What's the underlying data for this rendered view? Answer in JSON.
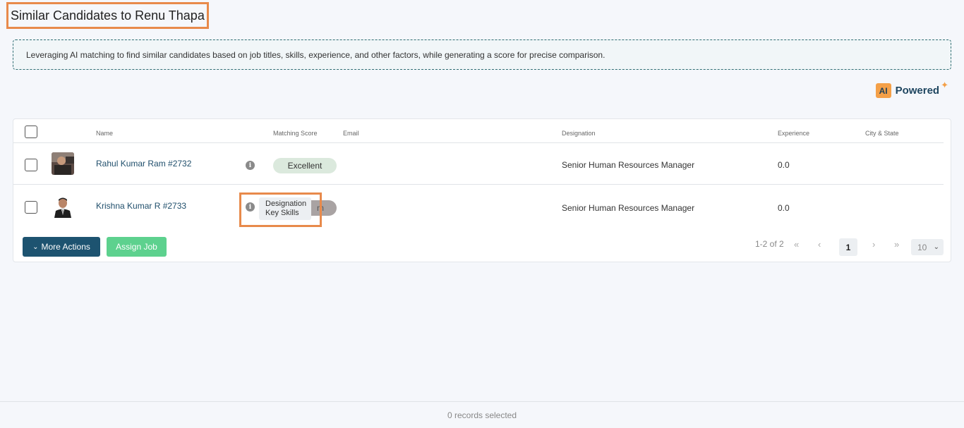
{
  "page": {
    "title": "Similar Candidates to Renu Thapa",
    "banner": "Leveraging AI matching to find similar candidates based on job titles, skills, experience, and other factors, while generating a score for precise comparison.",
    "ai_badge": "AI",
    "ai_label": "Powered"
  },
  "table": {
    "headers": {
      "name": "Name",
      "score": "Matching Score",
      "email": "Email",
      "designation": "Designation",
      "experience": "Experience",
      "city": "City & State"
    },
    "rows": [
      {
        "name": "Rahul Kumar Ram #2732",
        "score": "Excellent",
        "score_color": "#dbe9dd",
        "email": "",
        "designation": "Senior Human Resources Manager",
        "experience": "0.0",
        "city": ""
      },
      {
        "name": "Krishna Kumar R #2733",
        "score": "Excellent",
        "score_color": "#a9a3a3",
        "email": "",
        "designation": "Senior Human Resources Manager",
        "experience": "0.0",
        "city": ""
      }
    ],
    "tooltip": {
      "line1": "Designation",
      "line2": "Key Skills"
    },
    "partial_pill_text": "m"
  },
  "actions": {
    "more_actions": "More Actions",
    "assign_job": "Assign Job"
  },
  "pagination": {
    "range": "1-2 of 2",
    "current_page": "1",
    "page_size": "10"
  },
  "footer": {
    "selected": "0 records selected"
  },
  "colors": {
    "primary": "#1d5370",
    "accent": "#5dd18e",
    "highlight": "#e88a4b",
    "ai": "#f4a048"
  }
}
